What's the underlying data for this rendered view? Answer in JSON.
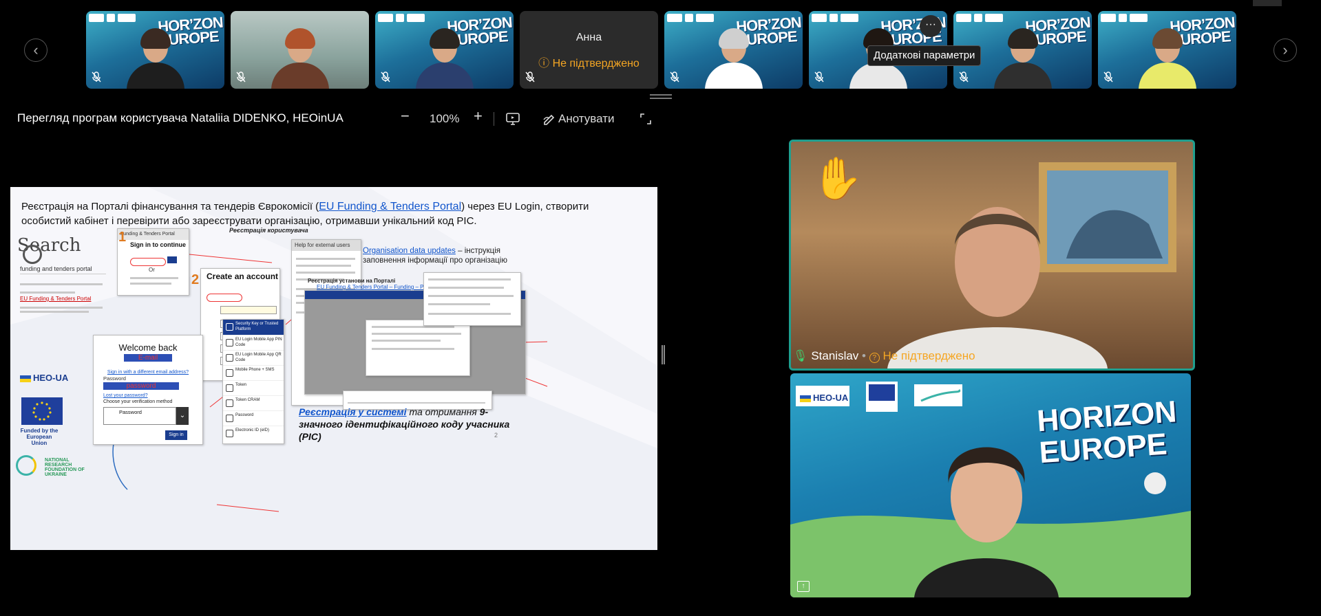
{
  "strip": {
    "prev_icon": "chevron-left-icon",
    "next_icon": "chevron-right-icon",
    "tiles": [
      {
        "kind": "video"
      },
      {
        "kind": "video"
      },
      {
        "kind": "video"
      },
      {
        "kind": "placeholder",
        "name": "Анна",
        "status": "Не підтверджено"
      },
      {
        "kind": "video"
      },
      {
        "kind": "video"
      },
      {
        "kind": "video"
      },
      {
        "kind": "video"
      }
    ],
    "more_tooltip": "Додаткові параметри",
    "more_glyph": "···",
    "muted_icon": "mic-off-icon"
  },
  "toolbar": {
    "title": "Перегляд програм користувача Nataliia DIDENKO, HEOinUA",
    "zoom_out": "−",
    "zoom": "100%",
    "zoom_in": "+",
    "annotate": "Анотувати"
  },
  "slide": {
    "heading_part1": "Реєстрація на Порталі фінансування та тендерів Єврокомісії (",
    "heading_link": "EU Funding & Tenders Portal",
    "heading_part2": ") через EU Login, створити особистий кабінет і перевірити або зареєструвати організацію, отримавши унікальний код PIC.",
    "search_word": "Search",
    "search_query": "funding and tenders portal",
    "result_link": "EU Funding & Tenders Portal",
    "signin_title": "Sign in to continue",
    "signin_or": "Or",
    "step1": "1",
    "step2": "2",
    "user_reg_label": "Реєстрація користувача",
    "create_account_title": "Create an account",
    "help_title": "Help for external users",
    "org_link": "Organisation data updates",
    "org_text": " – інструкція заповнення інформації про організацію",
    "org_reg_title": "Реєстрація установи на Порталі",
    "org_reg_link": "EU Funding & Tenders Portal – Funding – Participant register",
    "welcome_title": "Welcome back",
    "welcome_email": "E-mail",
    "signin_other": "Sign in with a different email address?",
    "password_label": "Password",
    "password_value": "password",
    "lost_password": "Lost your password?",
    "choose_method": "Choose your verification method",
    "method_password": "Password",
    "signin_button": "Sign in",
    "methods": [
      "Security Key or Trusted Platform",
      "EU Login Mobile App PIN Code",
      "EU Login Mobile App QR Code",
      "Mobile Phone + SMS",
      "Token",
      "Token CRAM",
      "Password",
      "Electronic ID (eID)"
    ],
    "heo_label": "HEO-UA",
    "eu_label": "Funded by the European Union",
    "nrf_label": "NATIONAL RESEARCH FOUNDATION OF UKRAINE",
    "pic_link": "Реєстрація у системі",
    "pic_text1": " та отримання ",
    "pic_bold": "9-значного ідентифікаційного коду учасника (PIC)",
    "page_number": "2"
  },
  "speaker": {
    "name": "Stanislav",
    "separator": "•",
    "status": "Не підтверджено",
    "hand_icon": "raised-hand-icon",
    "mic_icon": "mic-icon"
  },
  "presenter": {
    "logo_heo": "HEO-UA",
    "horizon": "HORIZON EUROPE",
    "share_icon": "share-screen-icon"
  }
}
